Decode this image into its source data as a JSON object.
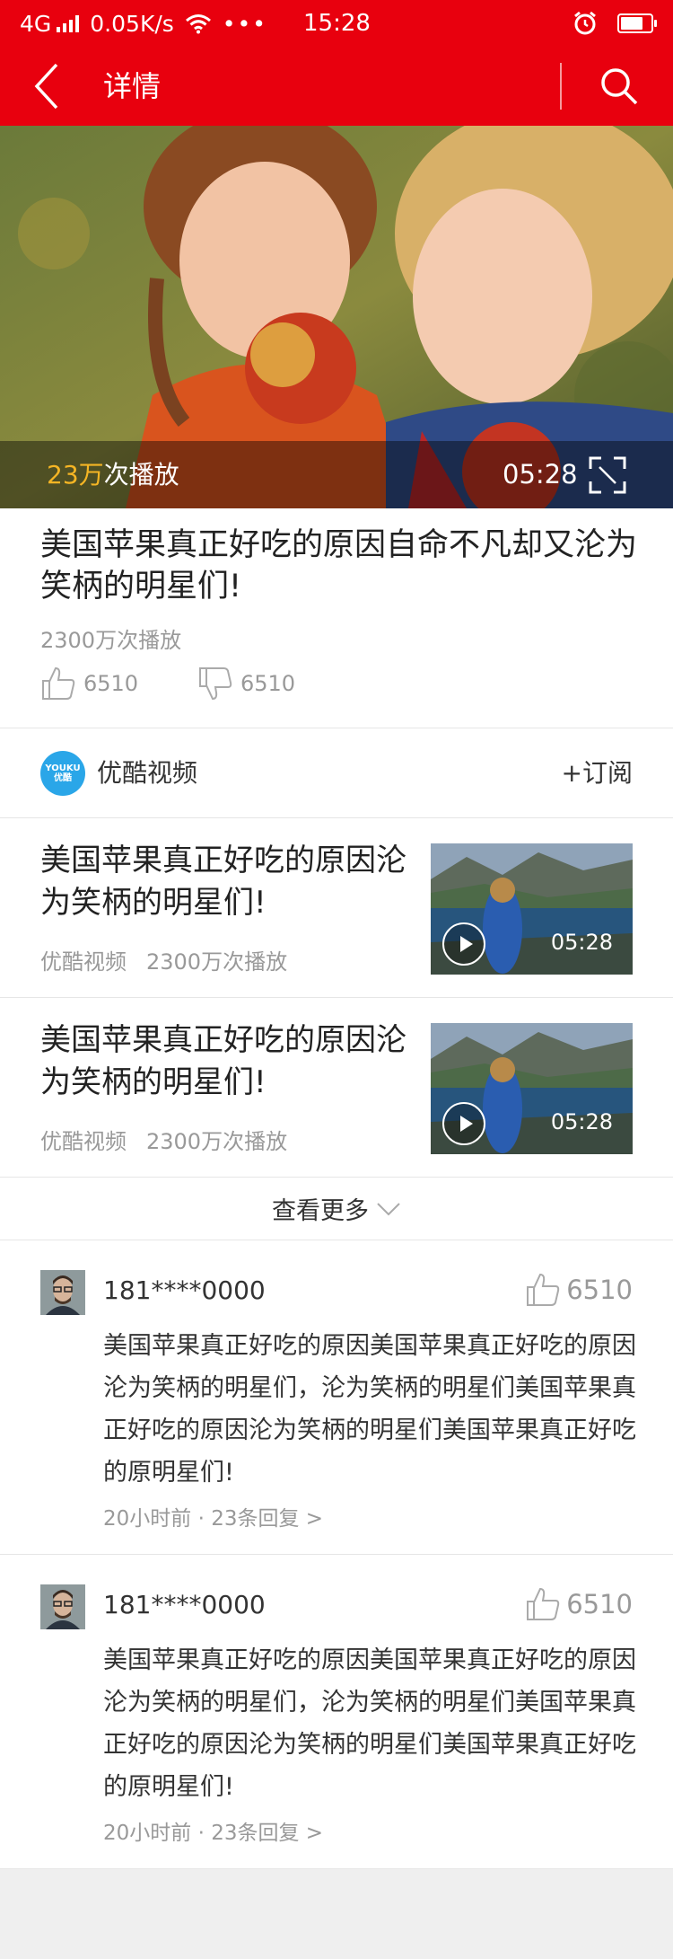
{
  "status_bar": {
    "network": "4G",
    "speed": "0.05K/s",
    "dots": "•••",
    "time": "15:28",
    "battery_level": 0.75
  },
  "nav": {
    "title": "详情"
  },
  "video": {
    "play_count_highlight": "23万",
    "play_count_suffix": "次播放",
    "duration": "05:28"
  },
  "info": {
    "title": "美国苹果真正好吃的原因自命不凡却又沦为笑柄的明星们!",
    "views": "2300万次播放",
    "likes": "6510",
    "dislikes": "6510"
  },
  "channel": {
    "logo_text_top": "YOUKU",
    "logo_text_bottom": "优酷",
    "name": "优酷视频",
    "subscribe_label": "+订阅"
  },
  "related": [
    {
      "title": "美国苹果真正好吃的原因沦为笑柄的明星们!",
      "source": "优酷视频",
      "views": "2300万次播放",
      "duration": "05:28"
    },
    {
      "title": "美国苹果真正好吃的原因沦为笑柄的明星们!",
      "source": "优酷视频",
      "views": "2300万次播放",
      "duration": "05:28"
    }
  ],
  "see_more": {
    "label": "查看更多"
  },
  "comments": [
    {
      "user": "181****0000",
      "likes": "6510",
      "text": "美国苹果真正好吃的原因美国苹果真正好吃的原因沦为笑柄的明星们，沦为笑柄的明星们美国苹果真正好吃的原因沦为笑柄的明星们美国苹果真正好吃的原明星们!",
      "meta": "20小时前 · 23条回复 >"
    },
    {
      "user": "181****0000",
      "likes": "6510",
      "text": "美国苹果真正好吃的原因美国苹果真正好吃的原因沦为笑柄的明星们，沦为笑柄的明星们美国苹果真正好吃的原因沦为笑柄的明星们美国苹果真正好吃的原明星们!",
      "meta": "20小时前 · 23条回复 >"
    }
  ],
  "colors": {
    "brand_red": "#e8000e",
    "highlight": "#f5b524",
    "muted_text": "#999999"
  },
  "icons": [
    "signal-icon",
    "wifi-icon",
    "alarm-icon",
    "battery-icon",
    "back-icon",
    "search-icon",
    "fullscreen-icon",
    "thumb-up-icon",
    "thumb-down-icon",
    "play-icon",
    "chevron-down-icon"
  ]
}
